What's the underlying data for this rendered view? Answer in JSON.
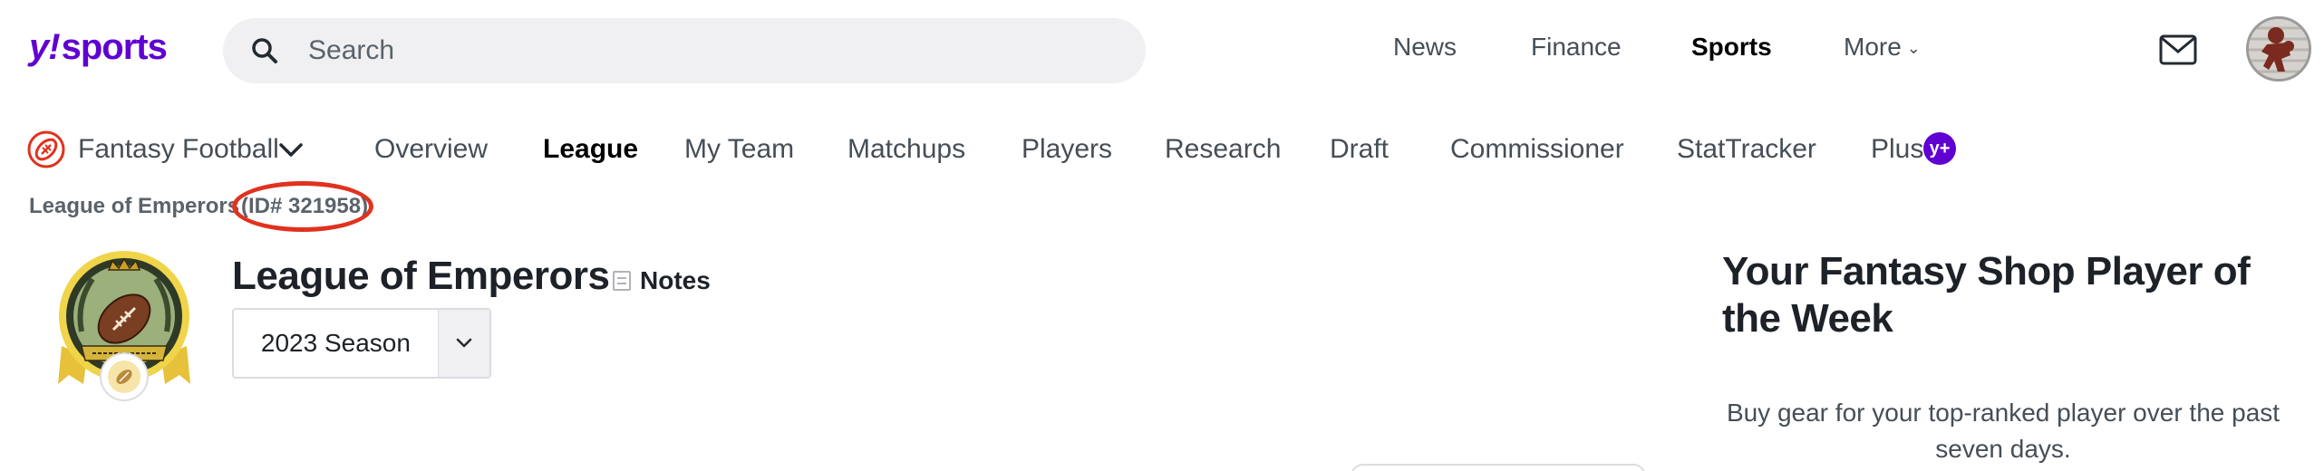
{
  "header": {
    "logo": {
      "y": "y",
      "bang": "!",
      "word": "sports"
    },
    "search": {
      "placeholder": "Search",
      "value": ""
    },
    "nav": [
      {
        "label": "News"
      },
      {
        "label": "Finance"
      },
      {
        "label": "Sports",
        "active": true
      },
      {
        "label": "More"
      }
    ]
  },
  "sub_nav": {
    "product": "Fantasy Football",
    "items": [
      {
        "label": "Overview"
      },
      {
        "label": "League",
        "active": true
      },
      {
        "label": "My Team"
      },
      {
        "label": "Matchups"
      },
      {
        "label": "Players"
      },
      {
        "label": "Research"
      },
      {
        "label": "Draft"
      },
      {
        "label": "Commissioner"
      },
      {
        "label": "StatTracker"
      },
      {
        "label": "Plus"
      }
    ],
    "plus_badge": "y+"
  },
  "breadcrumb": {
    "league": "League of Emperors",
    "id": "(ID# 321958)"
  },
  "league": {
    "title": "League of Emperors",
    "notes_label": "Notes",
    "season": "2023 Season"
  },
  "promo": {
    "title": "Your Fantasy Shop Player of the Week",
    "text": "Buy gear for your top-ranked player over the past seven days."
  },
  "colors": {
    "brand": "#6001d2",
    "annotation": "#e0321f",
    "fantasy_red": "#e0321f"
  }
}
